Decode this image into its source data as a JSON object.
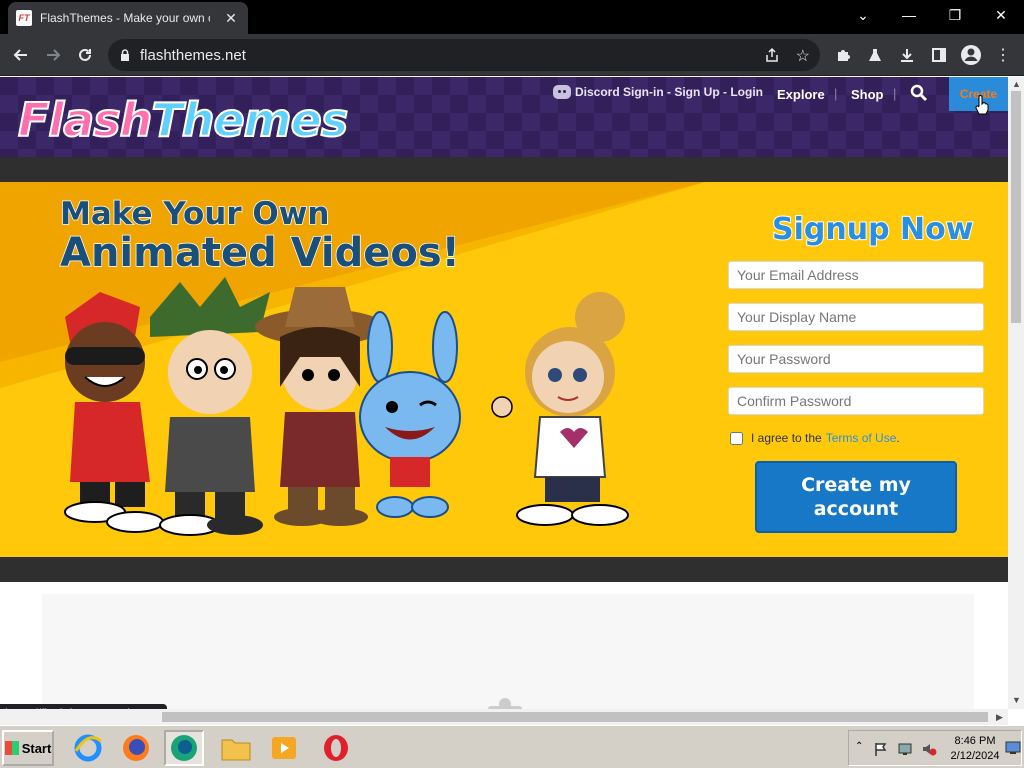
{
  "browser": {
    "tab": {
      "title": "FlashThemes - Make your own car",
      "favicon": "FT"
    },
    "url": "flashthemes.net",
    "status_url": "https://flashthemes.net/create"
  },
  "header": {
    "logo": {
      "part1": "Flash",
      "part2": "Themes"
    },
    "discord_label": "Discord Sign-in - Sign Up - Login",
    "nav": {
      "explore": "Explore",
      "shop": "Shop",
      "create": "Create"
    }
  },
  "hero": {
    "title_line1": "Make Your Own",
    "title_line2": "Animated Videos!"
  },
  "signup": {
    "title": "Signup Now",
    "email_placeholder": "Your Email Address",
    "display_name_placeholder": "Your Display Name",
    "password_placeholder": "Your Password",
    "confirm_password_placeholder": "Confirm Password",
    "agree_text": "I agree to the",
    "terms_link": "Terms of Use",
    "agree_period": ".",
    "submit_line1": "Create my",
    "submit_line2": "account"
  },
  "taskbar": {
    "start_label": "Start",
    "time": "8:46 PM",
    "date": "2/12/2024"
  },
  "colors": {
    "header_purple": "#33205a",
    "hero_yellow": "#ffc80a",
    "primary_blue": "#1878c8",
    "create_orange": "#f37c1f"
  }
}
